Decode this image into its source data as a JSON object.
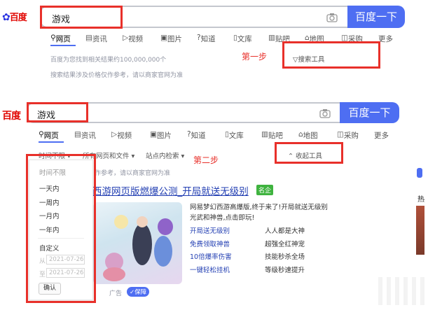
{
  "top": {
    "logo": "百度",
    "query": "游戏",
    "search_button": "百度一下",
    "tabs": [
      "网页",
      "资讯",
      "视频",
      "图片",
      "知道",
      "文库",
      "贴吧",
      "地图",
      "采购",
      "更多"
    ],
    "result_count": "百度为您找到相关结果约100,000,000个",
    "notice": "搜索结果涉及价格仅作参考，请以商家官网为准",
    "step_label": "第一步",
    "search_tools": "搜索工具"
  },
  "bottom": {
    "logo": "百度",
    "query": "游戏",
    "search_button": "百度一下",
    "tabs": [
      "网页",
      "资讯",
      "视频",
      "图片",
      "知道",
      "文库",
      "贴吧",
      "地图",
      "采购",
      "更多"
    ],
    "filters": [
      "时间不限",
      "所有网页和文件",
      "站点内检索"
    ],
    "step_label": "第二步",
    "collapse_tools": "收起工具",
    "notice_partial": "作参考，请以商家官网为准",
    "dropdown": {
      "items": [
        "时间不限",
        "一天内",
        "一周内",
        "一月内",
        "一年内"
      ],
      "custom": "自定义",
      "from_label": "从",
      "to_label": "至",
      "from_date": "2021-07-26",
      "to_date": "2021-07-26",
      "confirm": "确认"
    },
    "result": {
      "title": "西游网页版燃爆公测_开局就送无级别",
      "badge": "名企",
      "desc1": "网易梦幻西游高爆版,终于来了!开局就送无级别",
      "desc2": "光武和神兽,点击即玩!",
      "links": [
        "开局送无级别",
        "免费领取神兽",
        "10倍爆率伤害",
        "一键轻松挂机"
      ],
      "features": [
        "人人都是大神",
        "超强全红神宠",
        "技能秒杀全场",
        "等级秒速提升"
      ],
      "ad": "广告",
      "guarantee": "保障"
    },
    "side_partial": "热"
  },
  "colors": {
    "accent": "#4e6ef2",
    "annotation": "#e8302a",
    "link": "#2440b3",
    "badge": "#3fb33f"
  }
}
